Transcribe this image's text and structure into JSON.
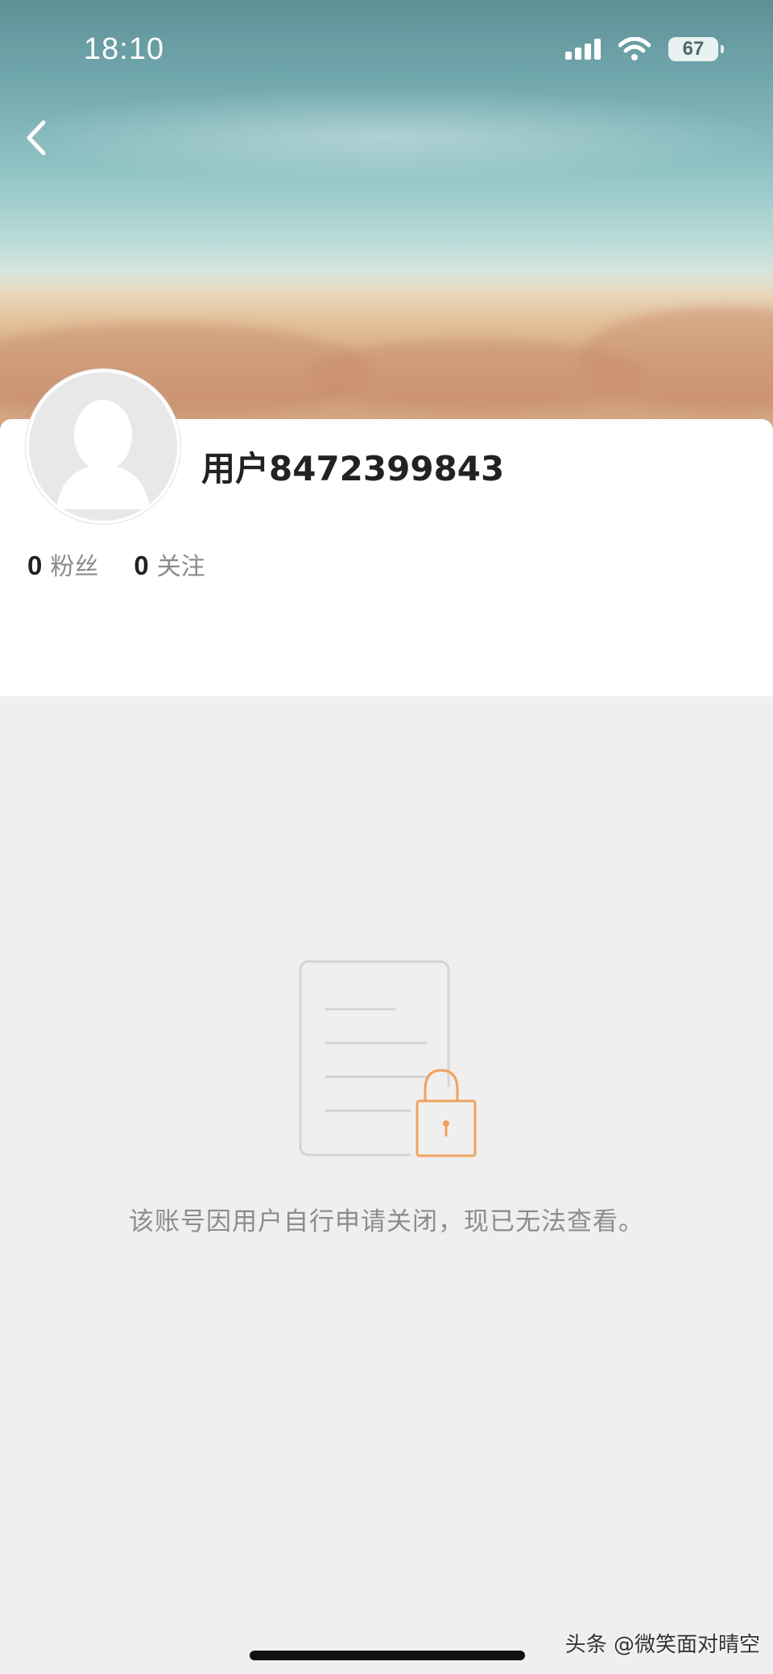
{
  "status_bar": {
    "time": "18:10",
    "battery": "67",
    "icons": [
      "signal-icon",
      "wifi-icon",
      "battery-icon"
    ]
  },
  "nav": {
    "back_icon": "chevron-left-icon"
  },
  "profile": {
    "username": "用户8472399843",
    "stats": [
      {
        "value": "0",
        "label": "粉丝"
      },
      {
        "value": "0",
        "label": "关注"
      }
    ]
  },
  "notice": {
    "icon": "locked-document-icon",
    "message": "该账号因用户自行申请关闭，现已无法查看。"
  },
  "watermark": "头条 @微笑面对晴空",
  "colors": {
    "accent_lock": "#f0a25e",
    "page_bg": "#efefef"
  }
}
